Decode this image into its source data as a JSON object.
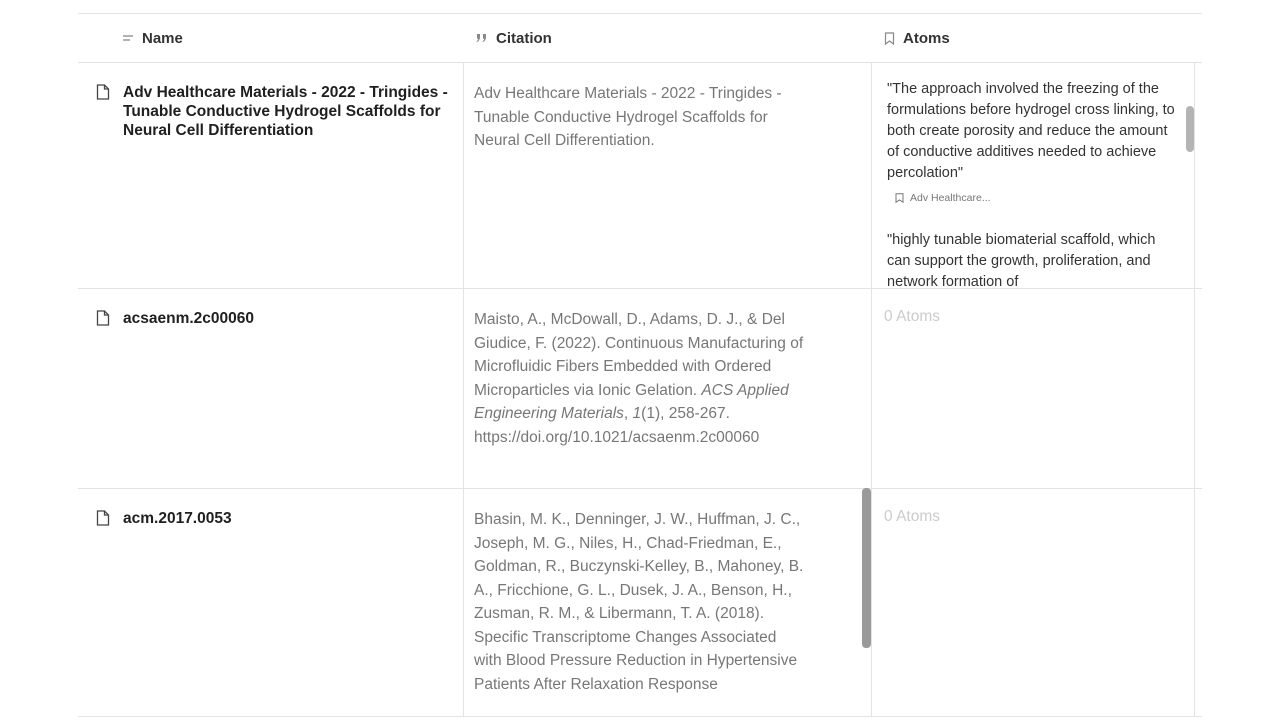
{
  "columns": {
    "name": {
      "label": "Name",
      "icon": "text-lines-icon"
    },
    "citation": {
      "label": "Citation",
      "icon": "quote-icon"
    },
    "atoms": {
      "label": "Atoms",
      "icon": "bookmark-icon"
    }
  },
  "rows": [
    {
      "name": "Adv Healthcare Materials - 2022 - Tringides - Tunable Conductive Hydrogel Scaffolds for Neural Cell Differentiation",
      "citation": {
        "plain": "Adv Healthcare Materials - 2022 - Tringides - Tunable Conductive Hydrogel Scaffolds for Neural Cell Differentiation."
      },
      "atoms": [
        {
          "quote": "\"The approach involved the freezing of the formulations before hydrogel cross linking, to both create porosity and reduce the amount of conductive additives needed to achieve percolation\"",
          "source": "Adv Healthcare..."
        },
        {
          "quote": "\"highly tunable biomaterial scaffold, which can support the growth, proliferation, and network formation of",
          "source": ""
        }
      ],
      "atoms_count_label": ""
    },
    {
      "name": "acsaenm.2c00060",
      "citation": {
        "before": "Maisto, A., McDowall, D., Adams, D. J., & Del Giudice, F. (2022). Continuous Manufacturing of Microfluidic Fibers Embedded with Ordered Microparticles via Ionic Gelation. ",
        "journal": "ACS Applied Engineering Materials",
        "mid": ", ",
        "volume": "1",
        "after": "(1), 258-267. https://doi.org/10.1021/acsaenm.2c00060"
      },
      "atoms": [],
      "atoms_count_label": "0 Atoms"
    },
    {
      "name": "acm.2017.0053",
      "citation": {
        "plain": "Bhasin, M. K., Denninger, J. W., Huffman, J. C., Joseph, M. G., Niles, H., Chad-Friedman, E., Goldman, R., Buczynski-Kelley, B., Mahoney, B. A., Fricchione, G. L., Dusek, J. A., Benson, H., Zusman, R. M., & Libermann, T. A. (2018). Specific Transcriptome Changes Associated with Blood Pressure Reduction in Hypertensive Patients After Relaxation Response"
      },
      "atoms": [],
      "atoms_count_label": "0 Atoms"
    }
  ]
}
